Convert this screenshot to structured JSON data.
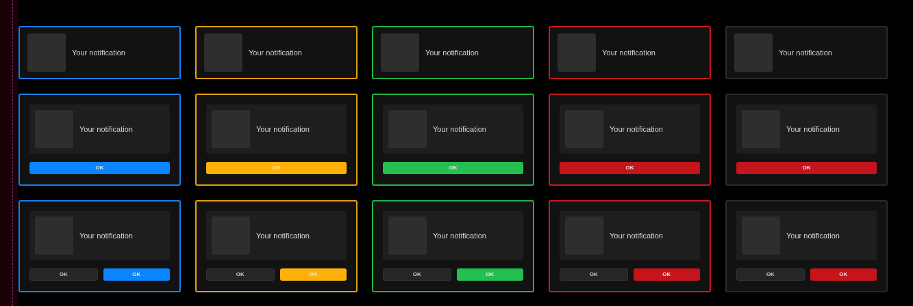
{
  "rows": [
    {
      "kind": "plain",
      "cards": [
        {
          "text": "Your notification",
          "color": "#1a7fe8"
        },
        {
          "text": "Your notification",
          "color": "#e0a010"
        },
        {
          "text": "Your notification",
          "color": "#22b04a"
        },
        {
          "text": "Your notification",
          "color": "#c8181e"
        },
        {
          "text": "Your notification",
          "color": "#2a2a2a"
        }
      ]
    },
    {
      "kind": "single",
      "cards": [
        {
          "text": "Your notification",
          "color": "#1a7fe8",
          "buttons": [
            {
              "label": "OK",
              "primary": true,
              "color": "#0a84ff"
            }
          ]
        },
        {
          "text": "Your notification",
          "color": "#e0a010",
          "buttons": [
            {
              "label": "OK",
              "primary": true,
              "color": "#ffb10a"
            }
          ]
        },
        {
          "text": "Your notification",
          "color": "#22b04a",
          "buttons": [
            {
              "label": "OK",
              "primary": true,
              "color": "#24c04f"
            }
          ]
        },
        {
          "text": "Your notification",
          "color": "#c8181e",
          "buttons": [
            {
              "label": "OK",
              "primary": true,
              "color": "#c4151c"
            }
          ]
        },
        {
          "text": "Your notification",
          "color": "#2a2a2a",
          "buttons": [
            {
              "label": "OK",
              "primary": true,
              "color": "#c4151c"
            }
          ]
        }
      ]
    },
    {
      "kind": "double",
      "cards": [
        {
          "text": "Your notification",
          "color": "#1a7fe8",
          "buttons": [
            {
              "label": "OK",
              "primary": false,
              "color": "#262626"
            },
            {
              "label": "OK",
              "primary": true,
              "color": "#0a84ff"
            }
          ]
        },
        {
          "text": "Your notification",
          "color": "#e0a010",
          "buttons": [
            {
              "label": "OK",
              "primary": false,
              "color": "#262626"
            },
            {
              "label": "OK",
              "primary": true,
              "color": "#ffb10a"
            }
          ]
        },
        {
          "text": "Your notification",
          "color": "#22b04a",
          "buttons": [
            {
              "label": "OK",
              "primary": false,
              "color": "#262626"
            },
            {
              "label": "OK",
              "primary": true,
              "color": "#24c04f"
            }
          ]
        },
        {
          "text": "Your notification",
          "color": "#c8181e",
          "buttons": [
            {
              "label": "OK",
              "primary": false,
              "color": "#262626"
            },
            {
              "label": "OK",
              "primary": true,
              "color": "#c4151c"
            }
          ]
        },
        {
          "text": "Your notification",
          "color": "#2a2a2a",
          "buttons": [
            {
              "label": "OK",
              "primary": false,
              "color": "#262626"
            },
            {
              "label": "OK",
              "primary": true,
              "color": "#c4151c"
            }
          ]
        }
      ]
    }
  ]
}
